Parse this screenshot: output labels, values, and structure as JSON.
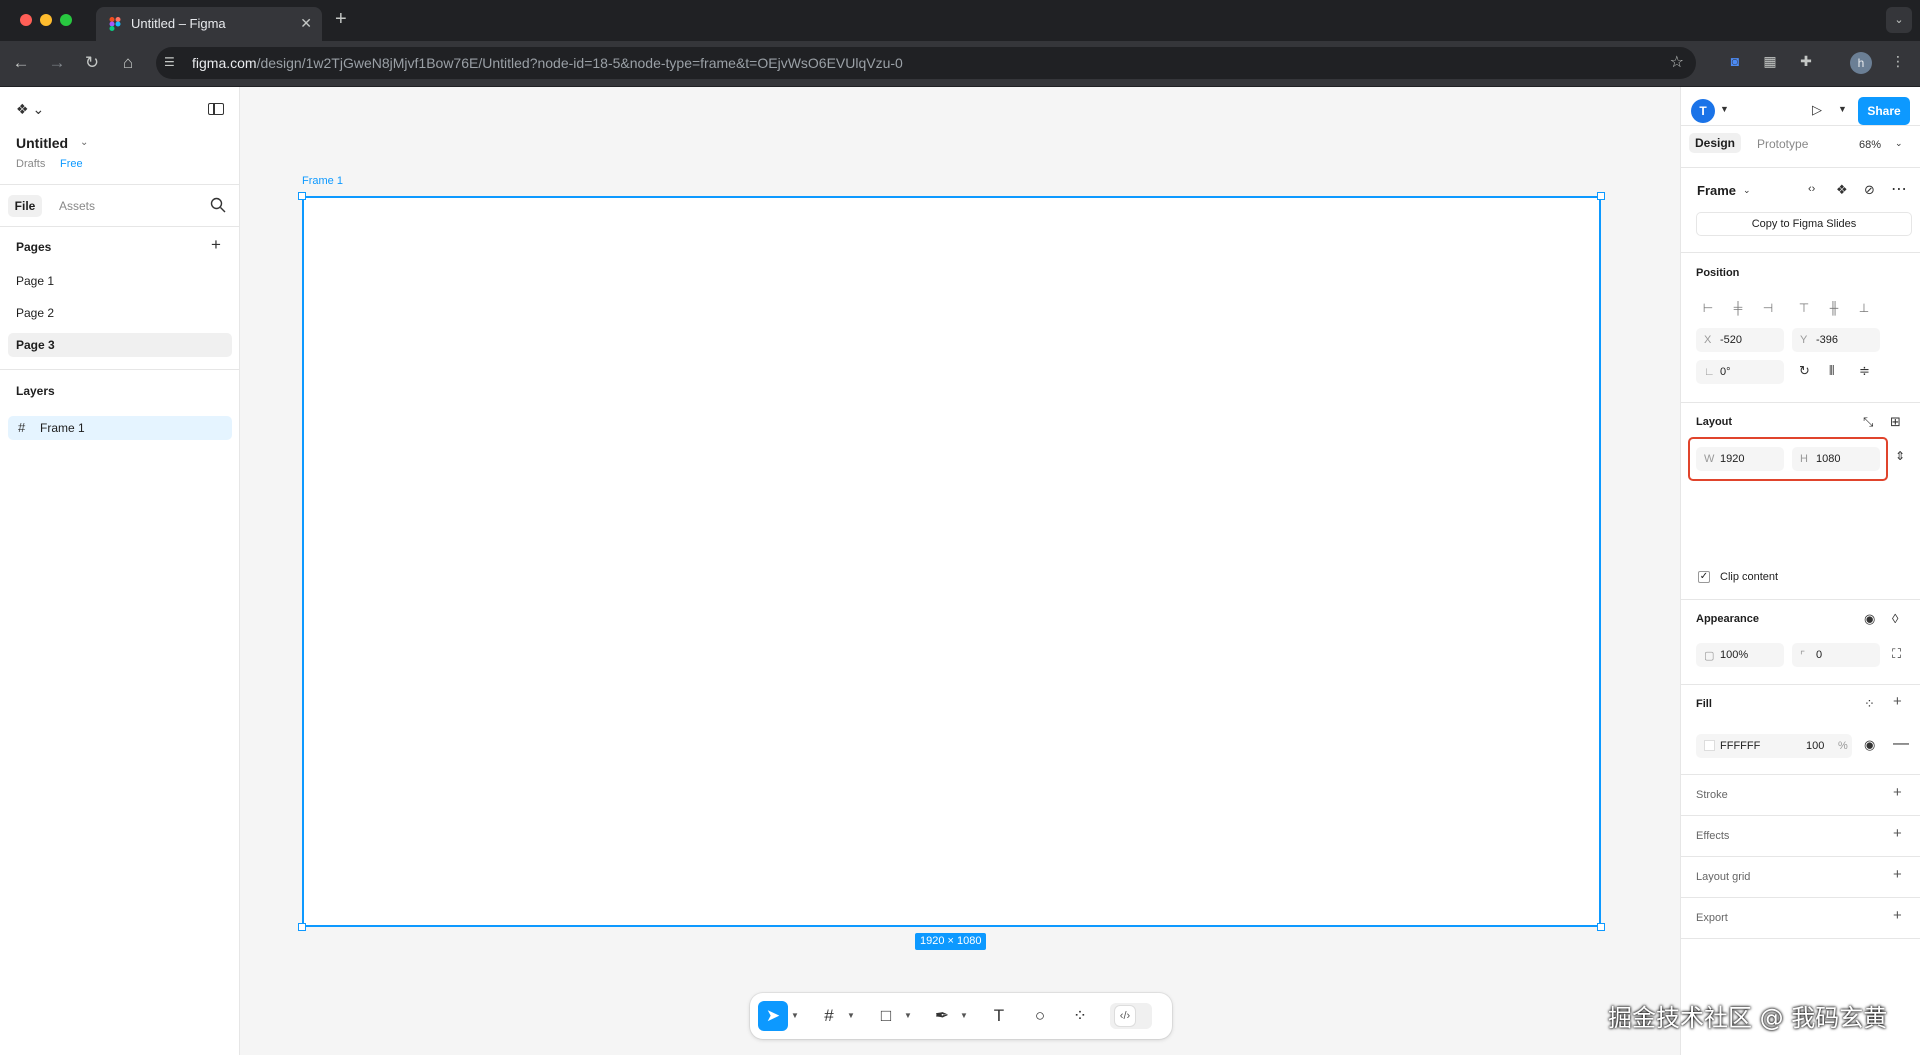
{
  "browser": {
    "tab_title": "Untitled – Figma",
    "url_host": "figma.com",
    "url_path": "/design/1w2TjGweN8jMjvf1Bow76E/Untitled?node-id=18-5&node-type=frame&t=OEjvWsO6EVUlqVzu-0",
    "profile_initial": "h"
  },
  "left_panel": {
    "file_title": "Untitled",
    "drafts_label": "Drafts",
    "plan_badge": "Free",
    "tabs": [
      "File",
      "Assets"
    ],
    "pages_heading": "Pages",
    "pages": [
      "Page 1",
      "Page 2",
      "Page 3"
    ],
    "active_page": "Page 3",
    "layers_heading": "Layers",
    "layers": [
      "Frame 1"
    ]
  },
  "canvas": {
    "frame_name": "Frame 1",
    "frame_size_label": "1920 × 1080",
    "selection_color": "#0d99ff"
  },
  "right_panel": {
    "user_initial": "T",
    "share_label": "Share",
    "tabs": [
      "Design",
      "Prototype"
    ],
    "zoom": "68%",
    "selection_type": "Frame",
    "copy_button": "Copy to Figma Slides",
    "position_heading": "Position",
    "x_label": "X",
    "x_value": "-520",
    "y_label": "Y",
    "y_value": "-396",
    "rotation_value": "0°",
    "layout_heading": "Layout",
    "w_label": "W",
    "w_value": "1920",
    "h_label": "H",
    "h_value": "1080",
    "clip_content_label": "Clip content",
    "appearance_heading": "Appearance",
    "opacity_value": "100%",
    "radius_value": "0",
    "fill_heading": "Fill",
    "fill_hex": "FFFFFF",
    "fill_opacity": "100",
    "fill_opacity_unit": "%",
    "stroke_heading": "Stroke",
    "effects_heading": "Effects",
    "layout_grid_heading": "Layout grid",
    "export_heading": "Export",
    "highlight_color": "#e0442c"
  },
  "watermark": "掘金技术社区 @ 我码玄黄"
}
